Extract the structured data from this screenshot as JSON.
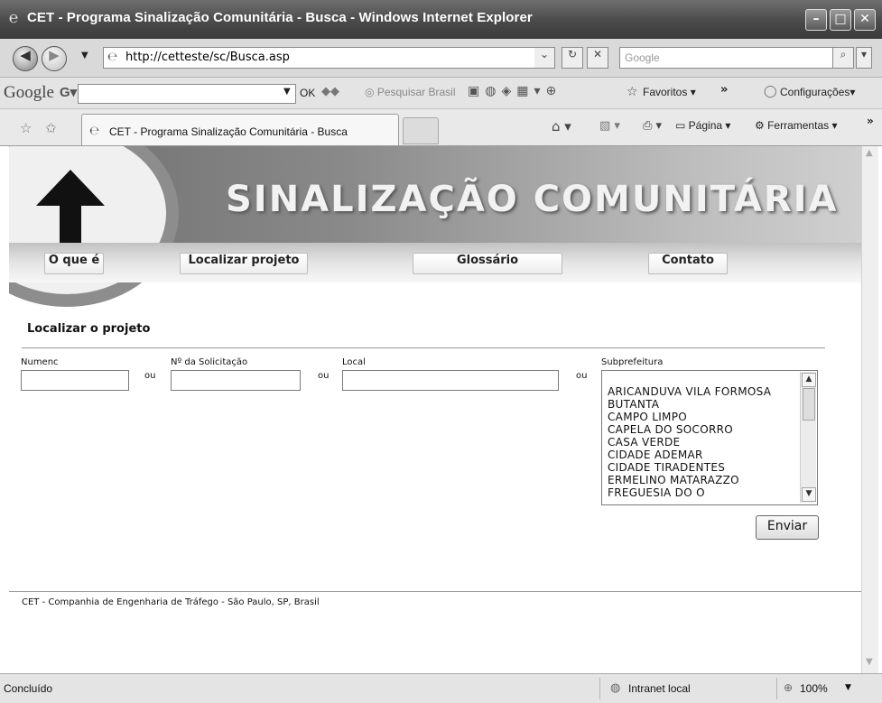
{
  "window": {
    "title": "CET - Programa Sinalização Comunitária - Busca - Windows Internet Explorer"
  },
  "address_bar": {
    "url": "http://cetteste/sc/Busca.asp",
    "search_placeholder": "Google"
  },
  "google_toolbar": {
    "logo": "Google",
    "ok_label": "OK",
    "search_label": "Pesquisar Brasil",
    "favorites_label": "Favoritos",
    "settings_label": "Configurações"
  },
  "tab_bar": {
    "tab_title": "CET - Programa Sinalização Comunitária - Busca",
    "page_label": "Página",
    "tools_label": "Ferramentas"
  },
  "banner": {
    "heading": "SINALIZAÇÃO COMUNITÁRIA"
  },
  "nav": {
    "items": [
      {
        "label": "O que é"
      },
      {
        "label": "Localizar projeto"
      },
      {
        "label": "Glossário"
      },
      {
        "label": "Contato"
      }
    ]
  },
  "form": {
    "title": "Localizar o projeto",
    "numenc_label": "Numenc",
    "solicitacao_label": "Nº da Solicitação",
    "local_label": "Local",
    "subprefeitura_label": "Subprefeitura",
    "ou_label": "ou",
    "subprefeituras": [
      "ARICANDUVA VILA FORMOSA",
      "BUTANTA",
      "CAMPO LIMPO",
      "CAPELA DO SOCORRO",
      "CASA VERDE",
      "CIDADE ADEMAR",
      "CIDADE TIRADENTES",
      "ERMELINO MATARAZZO",
      "FREGUESIA DO O"
    ],
    "submit_label": "Enviar"
  },
  "footer": {
    "text": "CET - Companhia de Engenharia de Tráfego - São Paulo, SP, Brasil"
  },
  "status_bar": {
    "status": "Concluído",
    "zone": "Intranet local",
    "zoom": "100%"
  }
}
